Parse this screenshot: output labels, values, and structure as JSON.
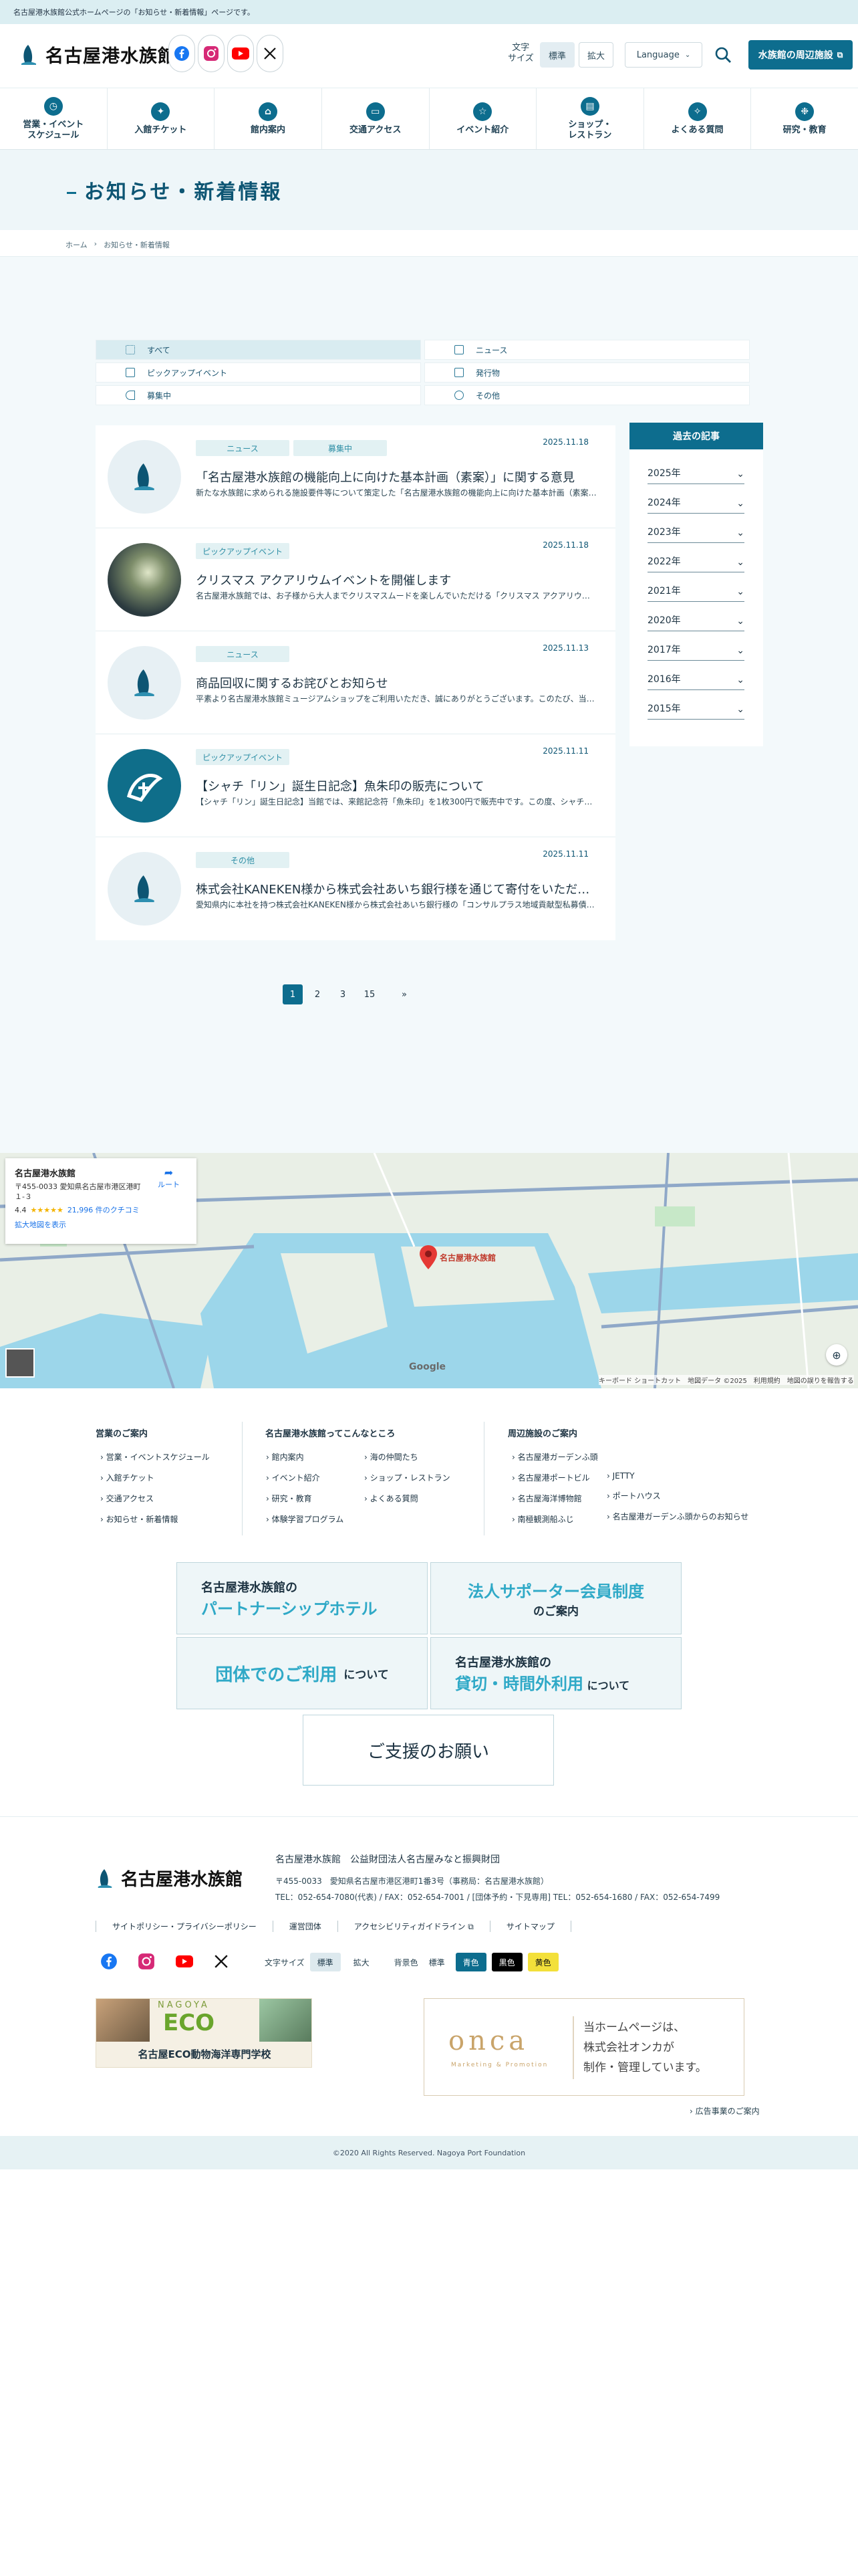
{
  "topbar": {
    "notice": "名古屋港水族館公式ホームページの「お知らせ・新着情報」ページです。"
  },
  "header": {
    "logo_text": "名古屋港水族館",
    "font_size_label": "文字\nサイズ",
    "font_standard": "標準",
    "font_large": "拡大",
    "language": "Language",
    "nearby_button": "水族館の周辺施設"
  },
  "nav": [
    {
      "label": "営業・イベント\nスケジュール",
      "icon": "clock-icon"
    },
    {
      "label": "入館チケット",
      "icon": "ticket-icon"
    },
    {
      "label": "館内案内",
      "icon": "building-icon"
    },
    {
      "label": "交通アクセス",
      "icon": "bus-icon"
    },
    {
      "label": "イベント紹介",
      "icon": "event-icon"
    },
    {
      "label": "ショップ・\nレストラン",
      "icon": "shop-icon"
    },
    {
      "label": "よくある質問",
      "icon": "bulb-icon"
    },
    {
      "label": "研究・教育",
      "icon": "research-icon"
    }
  ],
  "page": {
    "title": "お知らせ・新着情報"
  },
  "breadcrumb": {
    "home": "ホーム",
    "current": "お知らせ・新着情報"
  },
  "filters": {
    "all": "すべて",
    "news": "ニュース",
    "pickup": "ピックアップイベント",
    "released": "発行物",
    "recruit": "募集中",
    "other": "その他"
  },
  "news": [
    {
      "date": "2025.11.18",
      "tags": [
        "ニュース",
        "募集中"
      ],
      "title": "「名古屋港水族館の機能向上に向けた基本計画（素案）」に関する意見",
      "desc": "新たな水族館に求められる施設要件等について策定した「名古屋港水族館の機能向上に向けた基本計画（素案）」について"
    },
    {
      "date": "2025.11.18",
      "tags": [
        "ピックアップイベント"
      ],
      "title": "クリスマス アクアリウムイベントを開催します",
      "desc": "名古屋港水族館では、お子様から大人までクリスマスムードを楽しんでいただける「クリスマス アクアリウム」を開催します"
    },
    {
      "date": "2025.11.13",
      "tags": [
        "ニュース"
      ],
      "title": "商品回収に関するお詫びとお知らせ",
      "desc": "平素より名古屋港水族館ミュージアムショップをご利用いただき、誠にありがとうございます。このたび、当館で販売して"
    },
    {
      "date": "2025.11.11",
      "tags": [
        "ピックアップイベント"
      ],
      "title": "【シャチ「リン」誕生日記念】魚朱印の販売について",
      "desc": "【シャチ「リン」誕生日記念】当館では、来館記念符「魚朱印」を1枚300円で販売中です。この度、シャチ「リン」の"
    },
    {
      "date": "2025.11.11",
      "tags": [
        "その他"
      ],
      "title": "株式会社KANEKEN様から株式会社あいち銀行様を通じて寄付をいただきました",
      "desc": "愛知県内に本社を持つ株式会社KANEKEN様から株式会社あいち銀行様の「コンサルプラス地域貢献型私募債」を通じて"
    }
  ],
  "archive": {
    "heading": "過去の記事",
    "years": [
      "2025年",
      "2024年",
      "2023年",
      "2022年",
      "2021年",
      "2020年",
      "2017年",
      "2016年",
      "2015年"
    ]
  },
  "pagination": {
    "pages": [
      "1",
      "2",
      "3",
      "15"
    ],
    "current": "1",
    "next": "»"
  },
  "map": {
    "place_name": "名古屋港水族館",
    "address": "〒455-0033 愛知県名古屋市港区港町１-３",
    "rating": "4.4",
    "stars": "★★★★★",
    "reviews": "21,996 件のクチコミ",
    "route": "ルート",
    "enlarge": "拡大地図を表示",
    "pin_label": "名古屋港水族館",
    "google": "Google",
    "credits": "キーボード ショートカット　地図データ ©2025　利用規約　地図の誤りを報告する"
  },
  "footer": {
    "col1_title": "営業のご案内",
    "col1": [
      "営業・イベントスケジュール",
      "入館チケット",
      "交通アクセス",
      "お知らせ・新着情報"
    ],
    "col2_title": "名古屋港水族館ってこんなところ",
    "col2a": [
      "館内案内",
      "イベント紹介",
      "研究・教育",
      "体験学習プログラム"
    ],
    "col2b": [
      "海の仲間たち",
      "ショップ・レストラン",
      "よくある質問"
    ],
    "col3_title": "周辺施設のご案内",
    "col3a": [
      "名古屋港ガーデンふ頭",
      "名古屋港ポートビル",
      "名古屋海洋博物館",
      "南極観測船ふじ"
    ],
    "col3b": [
      "JETTY",
      "ポートハウス",
      "名古屋港ガーデンふ頭からのお知らせ"
    ],
    "banners": {
      "hotel_line1": "名古屋港水族館の",
      "hotel_line2": "パートナーシップホテル",
      "supporter_line1": "法人サポーター会員制度",
      "supporter_line2": "のご案内",
      "group_line1": "団体でのご利用",
      "group_line2": "について",
      "rental_line1": "名古屋港水族館の",
      "rental_line2": "貸切・時間外利用",
      "rental_line3": "について",
      "support": "ご支援のお願い"
    },
    "org_logo": "名古屋港水族館",
    "org_name": "名古屋港水族館　公益財団法人名古屋みなと振興財団",
    "address": "〒455-0033　愛知県名古屋市港区港町1番3号（事務局：名古屋港水族館）",
    "tel": "TEL：052-654-7080(代表) / FAX：052-654-7001 / [団体予約・下見専用] TEL：052-654-1680 / FAX：052-654-7499",
    "links": [
      "サイトポリシー・プライバシーポリシー",
      "運営団体",
      "アクセシビリティガイドライン",
      "サイトマップ"
    ],
    "font_size_label": "文字サイズ",
    "font_standard": "標準",
    "font_large": "拡大",
    "bg_label": "背景色",
    "bg_standard": "標準",
    "bg_blue": "青色",
    "bg_black": "黒色",
    "bg_yellow": "黄色",
    "eco_top": "NAGOYA",
    "eco_main": "ECO",
    "eco_school": "名古屋ECO動物海洋専門学校",
    "onca_logo": "onca",
    "onca_sub": "Marketing & Promotion",
    "onca_text": "当ホームページは、\n株式会社オンカが\n制作・管理しています。",
    "ad_link": "広告事業のご案内"
  },
  "copyright": "©2020 All Rights Reserved. Nagoya Port Foundation",
  "colors": {
    "brand": "#0d6d8e",
    "tag_bg": "#e2f1f3",
    "page_bg": "#f3f9fb"
  }
}
